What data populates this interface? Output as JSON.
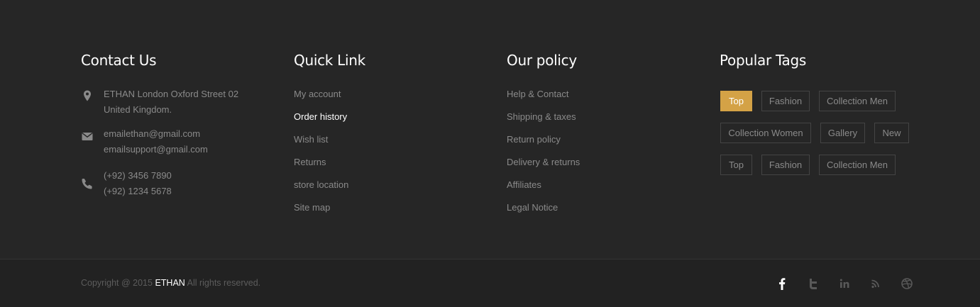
{
  "contact": {
    "title": "Contact Us",
    "address_line1": "ETHAN London Oxford Street 02",
    "address_line2": "United Kingdom.",
    "email1": "emailethan@gmail.com",
    "email2": "emailsupport@gmail.com",
    "phone1": "(+92) 3456 7890",
    "phone2": "(+92) 1234 5678",
    "icons": [
      "location-pin-icon",
      "envelope-icon",
      "phone-icon"
    ]
  },
  "quick_link": {
    "title": "Quick Link",
    "items": [
      {
        "label": "My account"
      },
      {
        "label": "Order history",
        "active": true
      },
      {
        "label": "Wish list"
      },
      {
        "label": "Returns"
      },
      {
        "label": "store location"
      },
      {
        "label": "Site map"
      }
    ]
  },
  "policy": {
    "title": "Our policy",
    "items": [
      {
        "label": "Help & Contact"
      },
      {
        "label": "Shipping & taxes"
      },
      {
        "label": "Return policy"
      },
      {
        "label": "Delivery & returns"
      },
      {
        "label": "Affiliates"
      },
      {
        "label": "Legal Notice"
      }
    ]
  },
  "tags": {
    "title": "Popular Tags",
    "items": [
      {
        "label": "Top",
        "active": true
      },
      {
        "label": "Fashion"
      },
      {
        "label": "Collection Men"
      },
      {
        "label": "Collection Women"
      },
      {
        "label": "Gallery"
      },
      {
        "label": "New"
      },
      {
        "label": "Top"
      },
      {
        "label": "Fashion"
      },
      {
        "label": "Collection Men"
      }
    ]
  },
  "bottom": {
    "copyright_prefix": "Copyright @ 2015",
    "brand": "ETHAN",
    "copyright_suffix": "All rights reserved.",
    "socials": [
      "facebook-icon",
      "twitter-icon",
      "linkedin-icon",
      "rss-icon",
      "dribbble-icon"
    ]
  },
  "colors": {
    "background": "#262626",
    "bottom_background": "#222222",
    "accent": "#d4a246",
    "text_muted": "#8a8a8a",
    "heading": "#ffffff"
  }
}
